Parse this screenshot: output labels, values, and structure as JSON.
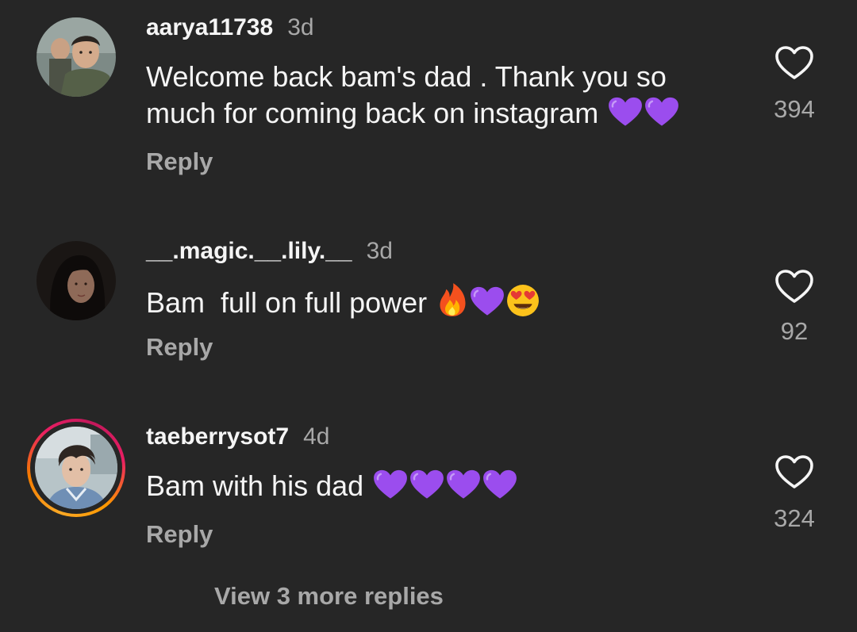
{
  "comments": [
    {
      "username": "aarya11738",
      "time": "3d",
      "text_line1": "Welcome back bam's dad . Thank you so",
      "text_line2": "much for coming back on instagram",
      "emojis": [
        "purple-heart",
        "purple-heart"
      ],
      "reply_label": "Reply",
      "likes": "394"
    },
    {
      "username": "__.magic.__.lily.__",
      "time": "3d",
      "text_line1": "Bam  full on full power",
      "emojis": [
        "fire",
        "purple-heart",
        "heart-eyes"
      ],
      "reply_label": "Reply",
      "likes": "92"
    },
    {
      "username": "taeberrysot7",
      "time": "4d",
      "text_line1": "Bam with his dad",
      "emojis": [
        "purple-heart",
        "purple-heart",
        "purple-heart",
        "purple-heart"
      ],
      "reply_label": "Reply",
      "likes": "324",
      "has_story_ring": true
    }
  ],
  "view_more_label": "View 3 more replies",
  "colors": {
    "background": "#262626",
    "primary_text": "#f5f5f5",
    "secondary_text": "#a8a8a8",
    "purple_heart": "#9b4dee"
  }
}
